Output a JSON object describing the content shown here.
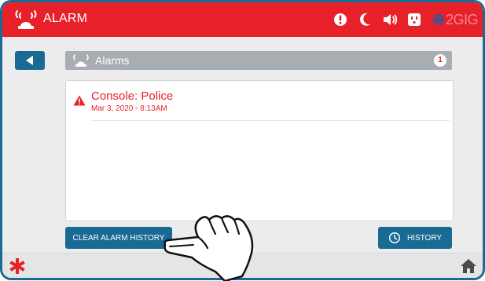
{
  "header": {
    "title": "ALARM",
    "brand": "2GIG",
    "status_icons": [
      "alert-icon",
      "moon-icon",
      "speaker-icon",
      "outlet-icon"
    ],
    "background_color": "#e8202a"
  },
  "nav": {
    "back_icon": "triangle-left-icon"
  },
  "alarms_header": {
    "label": "Alarms",
    "count": "1"
  },
  "alarms": [
    {
      "name": "Console: Police",
      "datetime": "Mar 3, 2020 - 8:13AM",
      "icon": "warning-icon"
    }
  ],
  "buttons": {
    "clear_label": "CLEAR ALARM HISTORY",
    "history_label": "HISTORY"
  },
  "footer": {
    "emergency_icon": "asterisk-icon",
    "home_icon": "home-icon"
  },
  "colors": {
    "accent": "#1a6b94",
    "alert": "#e8202a",
    "header_bar": "#a8adb3"
  }
}
